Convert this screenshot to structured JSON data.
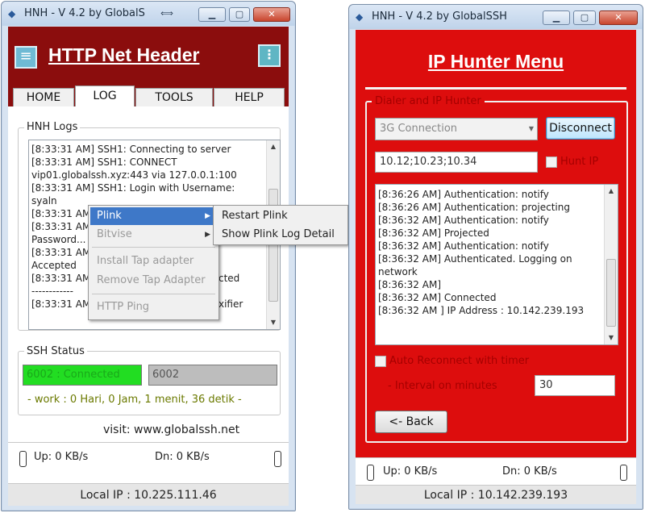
{
  "left_window": {
    "title": "HNH - V 4.2 by GlobalS",
    "app_title": "HTTP Net Header",
    "tabs": [
      {
        "label": "HOME"
      },
      {
        "label": "LOG"
      },
      {
        "label": "TOOLS"
      },
      {
        "label": "HELP"
      }
    ],
    "active_tab": "LOG",
    "logs_group_title": "HNH Logs",
    "log_lines": [
      "[8:33:31 AM] SSH1: Connecting to server",
      "[8:33:31 AM] SSH1: CONNECT",
      "vip01.globalssh.xyz:443 via 127.0.0.1:100",
      "[8:33:31 AM] SSH1: Login with Username:",
      "syaln",
      "[8:33:31 AM",
      "[8:33:31 AM",
      "Password...",
      "[8:33:31 AM",
      "Accepted",
      "[8:33:31 AM",
      "------------",
      "[8:33:31 AM"
    ],
    "log_line_tails": {
      "l10": "cted",
      "l12": "xifier"
    },
    "context_menu": {
      "items": [
        {
          "label": "Plink",
          "has_submenu": true,
          "highlighted": true,
          "disabled": false
        },
        {
          "label": "Bitvise",
          "has_submenu": true,
          "highlighted": false,
          "disabled": true
        },
        {
          "label": "Install Tap adapter",
          "has_submenu": false,
          "highlighted": false,
          "disabled": true
        },
        {
          "label": "Remove Tap Adapter",
          "has_submenu": false,
          "highlighted": false,
          "disabled": true
        },
        {
          "label": "HTTP Ping",
          "has_submenu": false,
          "highlighted": false,
          "disabled": true
        }
      ],
      "submenu": [
        {
          "label": "Restart Plink"
        },
        {
          "label": "Show Plink Log Detail"
        }
      ]
    },
    "ssh_group_title": "SSH Status",
    "ssh_status": "6002 : Connected",
    "ssh_port": "6002",
    "work_text": "- work : 0 Hari, 0 Jam, 1 menit, 36 detik -",
    "visit_text": "visit: www.globalssh.net",
    "up_text": "Up: 0 KB/s",
    "down_text": "Dn: 0 KB/s",
    "local_ip_text": "Local IP : 10.225.111.46"
  },
  "right_window": {
    "title": "HNH - V 4.2 by GlobalSSH",
    "menu_title": "IP Hunter Menu",
    "group_title": "Dialer and IP Hunter",
    "connection_select": "3G Connection",
    "disconnect_label": "Disconnect",
    "ip_prefix_value": "10.12;10.23;10.34",
    "hunt_ip_label": "Hunt IP",
    "log_lines": [
      "[8:36:26 AM] Authentication: notify",
      "[8:36:26 AM] Authentication: projecting",
      "[8:36:32 AM] Authentication: notify",
      "[8:36:32 AM] Projected",
      "[8:36:32 AM] Authentication: notify",
      "[8:36:32 AM] Authenticated. Logging on",
      "network",
      "[8:36:32 AM]",
      "[8:36:32 AM] Connected",
      "[8:36:32 AM ] IP Address : 10.142.239.193"
    ],
    "auto_reconnect_label": "Auto Reconnect with timer",
    "interval_label": "- Interval on minutes",
    "interval_value": "30",
    "back_label": "<- Back",
    "up_text": "Up: 0 KB/s",
    "down_text": "Dn: 0 KB/s",
    "local_ip_text": "Local IP : 10.142.239.193"
  },
  "colors": {
    "left_header_red": "#8b0d0d",
    "right_panel_red": "#dd0d0d",
    "status_green": "#22dd22",
    "menu_highlight": "#3e78c8",
    "work_text": "#6b7a00"
  },
  "icons": {
    "hamburger": "hamburger-menu-icon",
    "info": "info-icon",
    "app": "app-icon",
    "submenu_arrow": "submenu-arrow-icon"
  }
}
